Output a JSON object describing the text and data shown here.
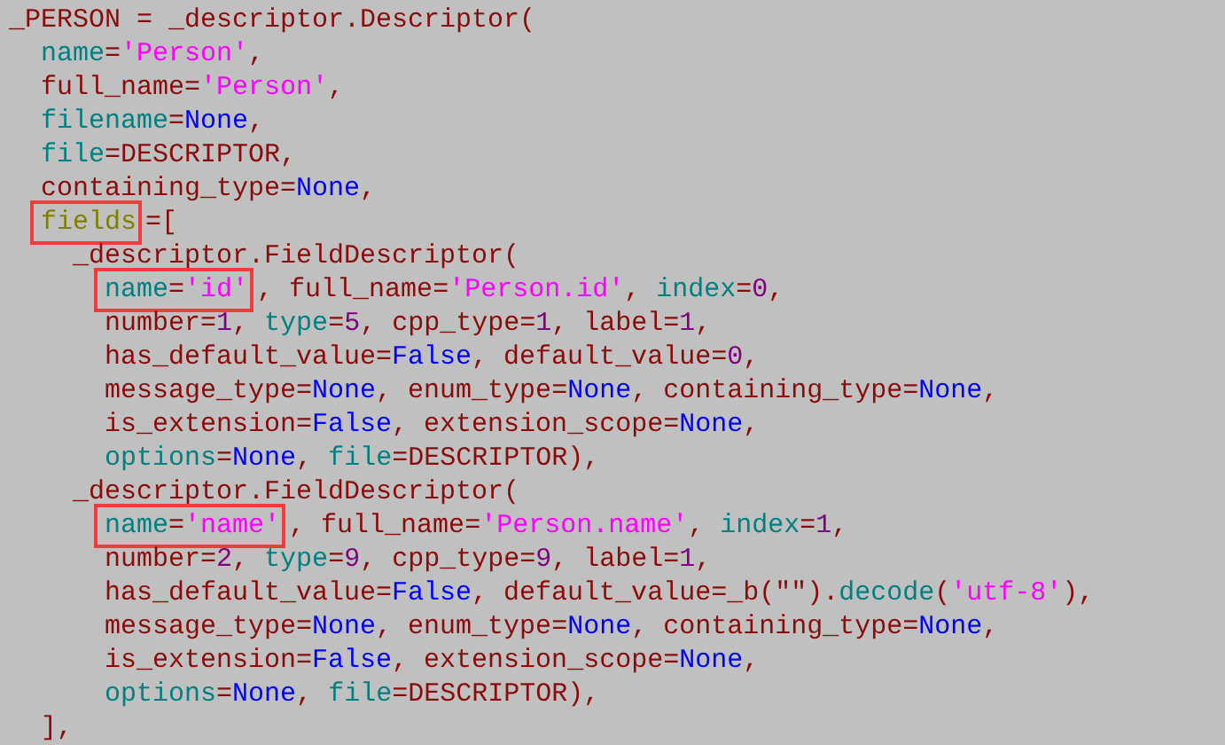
{
  "code_lines": [
    {
      "tokens": [
        {
          "kind": "plain",
          "text": "_PERSON = _descriptor.Descriptor("
        }
      ],
      "children": [
        {
          "tokens": [
            {
              "kind": "builtin",
              "text": "name"
            },
            {
              "kind": "plain",
              "text": "="
            },
            {
              "kind": "string",
              "text": "'Person'"
            },
            {
              "kind": "plain",
              "text": ","
            }
          ]
        },
        {
          "tokens": [
            {
              "kind": "plain",
              "text": "full_name="
            },
            {
              "kind": "string",
              "text": "'Person'"
            },
            {
              "kind": "plain",
              "text": ","
            }
          ]
        },
        {
          "tokens": [
            {
              "kind": "builtin",
              "text": "filename"
            },
            {
              "kind": "plain",
              "text": "="
            },
            {
              "kind": "constant",
              "text": "None"
            },
            {
              "kind": "plain",
              "text": ","
            }
          ]
        },
        {
          "tokens": [
            {
              "kind": "builtin",
              "text": "file"
            },
            {
              "kind": "plain",
              "text": "=DESCRIPTOR,"
            }
          ]
        },
        {
          "tokens": [
            {
              "kind": "plain",
              "text": "containing_type="
            },
            {
              "kind": "constant",
              "text": "None"
            },
            {
              "kind": "plain",
              "text": ","
            }
          ]
        },
        {
          "tokens": [
            {
              "kind": "box",
              "tokens": [
                {
                  "kind": "field",
                  "text": "fields"
                }
              ]
            },
            {
              "kind": "plain",
              "text": "=["
            }
          ],
          "children": [
            {
              "tokens": [
                {
                  "kind": "plain",
                  "text": "_descriptor.FieldDescriptor("
                }
              ],
              "children": [
                {
                  "tokens": [
                    {
                      "kind": "box",
                      "tokens": [
                        {
                          "kind": "builtin",
                          "text": "name"
                        },
                        {
                          "kind": "plain",
                          "text": "="
                        },
                        {
                          "kind": "string",
                          "text": "'id'"
                        }
                      ]
                    },
                    {
                      "kind": "plain",
                      "text": ", full_name="
                    },
                    {
                      "kind": "string",
                      "text": "'Person.id'"
                    },
                    {
                      "kind": "plain",
                      "text": ", "
                    },
                    {
                      "kind": "builtin",
                      "text": "index"
                    },
                    {
                      "kind": "plain",
                      "text": "="
                    },
                    {
                      "kind": "number",
                      "text": "0"
                    },
                    {
                      "kind": "plain",
                      "text": ","
                    }
                  ]
                },
                {
                  "tokens": [
                    {
                      "kind": "plain",
                      "text": "number="
                    },
                    {
                      "kind": "number",
                      "text": "1"
                    },
                    {
                      "kind": "plain",
                      "text": ", "
                    },
                    {
                      "kind": "builtin",
                      "text": "type"
                    },
                    {
                      "kind": "plain",
                      "text": "="
                    },
                    {
                      "kind": "number",
                      "text": "5"
                    },
                    {
                      "kind": "plain",
                      "text": ", cpp_type="
                    },
                    {
                      "kind": "number",
                      "text": "1"
                    },
                    {
                      "kind": "plain",
                      "text": ", label="
                    },
                    {
                      "kind": "number",
                      "text": "1"
                    },
                    {
                      "kind": "plain",
                      "text": ","
                    }
                  ]
                },
                {
                  "tokens": [
                    {
                      "kind": "plain",
                      "text": "has_default_value="
                    },
                    {
                      "kind": "constant",
                      "text": "False"
                    },
                    {
                      "kind": "plain",
                      "text": ", default_value="
                    },
                    {
                      "kind": "number",
                      "text": "0"
                    },
                    {
                      "kind": "plain",
                      "text": ","
                    }
                  ]
                },
                {
                  "tokens": [
                    {
                      "kind": "plain",
                      "text": "message_type="
                    },
                    {
                      "kind": "constant",
                      "text": "None"
                    },
                    {
                      "kind": "plain",
                      "text": ", enum_type="
                    },
                    {
                      "kind": "constant",
                      "text": "None"
                    },
                    {
                      "kind": "plain",
                      "text": ", containing_type="
                    },
                    {
                      "kind": "constant",
                      "text": "None"
                    },
                    {
                      "kind": "plain",
                      "text": ","
                    }
                  ]
                },
                {
                  "tokens": [
                    {
                      "kind": "plain",
                      "text": "is_extension="
                    },
                    {
                      "kind": "constant",
                      "text": "False"
                    },
                    {
                      "kind": "plain",
                      "text": ", extension_scope="
                    },
                    {
                      "kind": "constant",
                      "text": "None"
                    },
                    {
                      "kind": "plain",
                      "text": ","
                    }
                  ]
                },
                {
                  "tokens": [
                    {
                      "kind": "builtin",
                      "text": "options"
                    },
                    {
                      "kind": "plain",
                      "text": "="
                    },
                    {
                      "kind": "constant",
                      "text": "None"
                    },
                    {
                      "kind": "plain",
                      "text": ", "
                    },
                    {
                      "kind": "builtin",
                      "text": "file"
                    },
                    {
                      "kind": "plain",
                      "text": "=DESCRIPTOR),"
                    }
                  ]
                }
              ]
            },
            {
              "tokens": [
                {
                  "kind": "plain",
                  "text": "_descriptor.FieldDescriptor("
                }
              ],
              "children": [
                {
                  "tokens": [
                    {
                      "kind": "box",
                      "tokens": [
                        {
                          "kind": "builtin",
                          "text": "name"
                        },
                        {
                          "kind": "plain",
                          "text": "="
                        },
                        {
                          "kind": "string",
                          "text": "'name'"
                        }
                      ]
                    },
                    {
                      "kind": "plain",
                      "text": ", full_name="
                    },
                    {
                      "kind": "string",
                      "text": "'Person.name'"
                    },
                    {
                      "kind": "plain",
                      "text": ", "
                    },
                    {
                      "kind": "builtin",
                      "text": "index"
                    },
                    {
                      "kind": "plain",
                      "text": "="
                    },
                    {
                      "kind": "number",
                      "text": "1"
                    },
                    {
                      "kind": "plain",
                      "text": ","
                    }
                  ]
                },
                {
                  "tokens": [
                    {
                      "kind": "plain",
                      "text": "number="
                    },
                    {
                      "kind": "number",
                      "text": "2"
                    },
                    {
                      "kind": "plain",
                      "text": ", "
                    },
                    {
                      "kind": "builtin",
                      "text": "type"
                    },
                    {
                      "kind": "plain",
                      "text": "="
                    },
                    {
                      "kind": "number",
                      "text": "9"
                    },
                    {
                      "kind": "plain",
                      "text": ", cpp_type="
                    },
                    {
                      "kind": "number",
                      "text": "9"
                    },
                    {
                      "kind": "plain",
                      "text": ", label="
                    },
                    {
                      "kind": "number",
                      "text": "1"
                    },
                    {
                      "kind": "plain",
                      "text": ","
                    }
                  ]
                },
                {
                  "tokens": [
                    {
                      "kind": "plain",
                      "text": "has_default_value="
                    },
                    {
                      "kind": "constant",
                      "text": "False"
                    },
                    {
                      "kind": "plain",
                      "text": ", default_value=_b(\"\")."
                    },
                    {
                      "kind": "builtin",
                      "text": "decode"
                    },
                    {
                      "kind": "plain",
                      "text": "("
                    },
                    {
                      "kind": "string",
                      "text": "'utf-8'"
                    },
                    {
                      "kind": "plain",
                      "text": "),"
                    }
                  ]
                },
                {
                  "tokens": [
                    {
                      "kind": "plain",
                      "text": "message_type="
                    },
                    {
                      "kind": "constant",
                      "text": "None"
                    },
                    {
                      "kind": "plain",
                      "text": ", enum_type="
                    },
                    {
                      "kind": "constant",
                      "text": "None"
                    },
                    {
                      "kind": "plain",
                      "text": ", containing_type="
                    },
                    {
                      "kind": "constant",
                      "text": "None"
                    },
                    {
                      "kind": "plain",
                      "text": ","
                    }
                  ]
                },
                {
                  "tokens": [
                    {
                      "kind": "plain",
                      "text": "is_extension="
                    },
                    {
                      "kind": "constant",
                      "text": "False"
                    },
                    {
                      "kind": "plain",
                      "text": ", extension_scope="
                    },
                    {
                      "kind": "constant",
                      "text": "None"
                    },
                    {
                      "kind": "plain",
                      "text": ","
                    }
                  ]
                },
                {
                  "tokens": [
                    {
                      "kind": "builtin",
                      "text": "options"
                    },
                    {
                      "kind": "plain",
                      "text": "="
                    },
                    {
                      "kind": "constant",
                      "text": "None"
                    },
                    {
                      "kind": "plain",
                      "text": ", "
                    },
                    {
                      "kind": "builtin",
                      "text": "file"
                    },
                    {
                      "kind": "plain",
                      "text": "=DESCRIPTOR),"
                    }
                  ]
                }
              ]
            }
          ]
        },
        {
          "tokens": [
            {
              "kind": "plain",
              "text": "],"
            }
          ]
        }
      ]
    }
  ]
}
